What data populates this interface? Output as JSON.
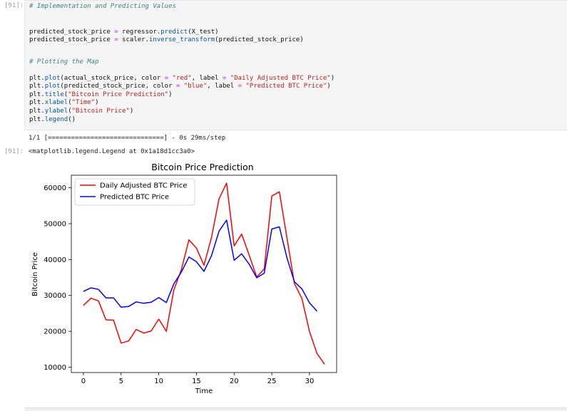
{
  "cell": {
    "input_prompt": "[91]:",
    "output_prompt": "[91]:",
    "lines": [
      "# Implementation and Predicting Values",
      "",
      "predicted_stock_price = regressor.predict(X_test)",
      "predicted_stock_price = scaler.inverse_transform(predicted_stock_price)",
      "",
      "",
      "# Plotting the Map",
      "",
      "plt.plot(actual_stock_price, color = \"red\", label = \"Daily Adjusted BTC Price\")",
      "plt.plot(predicted_stock_price, color = \"blue\", label = \"Predicted BTC Price\")",
      "plt.title(\"Bitcoin Price Prediction\")",
      "plt.xlabel(\"Time\")",
      "plt.ylabel(\"Bitcoin Price\")",
      "plt.legend()"
    ],
    "progress": "1/1 [==============================] - 0s 29ms/step",
    "result": "<matplotlib.legend.Legend at 0x1a18d1cc3a0>"
  },
  "chart_data": {
    "type": "line",
    "title": "Bitcoin Price Prediction",
    "xlabel": "Time",
    "ylabel": "Bitcoin Price",
    "xlim": [
      -1.6,
      33.6
    ],
    "ylim": [
      8500,
      63500
    ],
    "xticks": [
      0,
      5,
      10,
      15,
      20,
      25,
      30
    ],
    "yticks": [
      10000,
      20000,
      30000,
      40000,
      50000,
      60000
    ],
    "legend_position": "top-left",
    "series": [
      {
        "name": "Daily Adjusted BTC Price",
        "color": "#ff0000",
        "x": [
          0,
          1,
          2,
          3,
          4,
          5,
          6,
          7,
          8,
          9,
          10,
          11,
          12,
          13,
          14,
          15,
          16,
          17,
          18,
          19,
          20,
          21,
          22,
          23,
          24,
          25,
          26,
          27,
          28,
          29,
          30,
          31,
          32
        ],
        "values": [
          27200,
          29200,
          28500,
          23200,
          23100,
          16700,
          17300,
          20500,
          19500,
          20100,
          23400,
          20000,
          31500,
          37200,
          45500,
          43200,
          38400,
          46200,
          56900,
          61300,
          43800,
          47100,
          41200,
          35100,
          37400,
          57700,
          58900,
          46100,
          33300,
          29100,
          19900,
          13800,
          10800
        ]
      },
      {
        "name": "Predicted BTC Price",
        "color": "#0000ff",
        "x": [
          0,
          1,
          2,
          3,
          4,
          5,
          6,
          7,
          8,
          9,
          10,
          11,
          12,
          13,
          14,
          15,
          16,
          17,
          18,
          19,
          20,
          21,
          22,
          23,
          24,
          25,
          26,
          27,
          28,
          29,
          30,
          31
        ],
        "values": [
          31100,
          32100,
          31700,
          29300,
          29300,
          26700,
          26900,
          28200,
          27800,
          28100,
          29400,
          28000,
          33200,
          36500,
          40700,
          39400,
          36700,
          41100,
          47900,
          51000,
          39800,
          41600,
          38700,
          34900,
          36200,
          48500,
          49100,
          40500,
          33800,
          31800,
          27900,
          25600
        ]
      }
    ]
  }
}
